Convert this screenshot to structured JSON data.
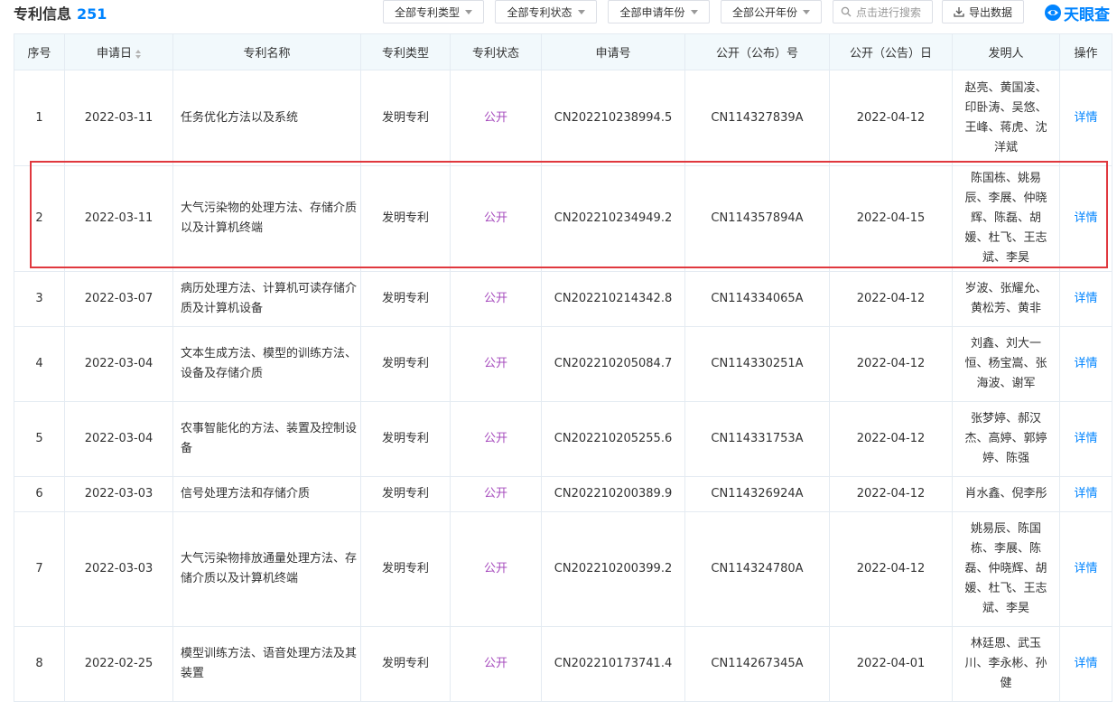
{
  "header": {
    "title": "专利信息",
    "count": "251",
    "filters": {
      "type": "全部专利类型",
      "status": "全部专利状态",
      "apply_year": "全部申请年份",
      "publish_year": "全部公开年份"
    },
    "search_placeholder": "点击进行搜索",
    "export_label": "导出数据",
    "logo_text": "天眼查"
  },
  "table": {
    "columns": [
      "序号",
      "申请日",
      "专利名称",
      "专利类型",
      "专利状态",
      "申请号",
      "公开（公布）号",
      "公开（公告）日",
      "发明人",
      "操作"
    ],
    "rows": [
      {
        "seq": "1",
        "apply_date": "2022-03-11",
        "name": "任务优化方法以及系统",
        "type": "发明专利",
        "status": "公开",
        "app_no": "CN202210238994.5",
        "pub_no": "CN114327839A",
        "pub_date": "2022-04-12",
        "inventors": [
          "赵亮、黄国凌、",
          "印卧涛、吴悠、",
          "王峰、蒋虎、沈",
          "洋斌"
        ],
        "action": "详情"
      },
      {
        "seq": "2",
        "apply_date": "2022-03-11",
        "name": "大气污染物的处理方法、存储介质以及计算机终端",
        "type": "发明专利",
        "status": "公开",
        "app_no": "CN202210234949.2",
        "pub_no": "CN114357894A",
        "pub_date": "2022-04-15",
        "inventors": [
          "陈国栋、姚易",
          "辰、李展、仲晓",
          "辉、陈磊、胡",
          "媛、杜飞、王志",
          "斌、李昊"
        ],
        "action": "详情"
      },
      {
        "seq": "3",
        "apply_date": "2022-03-07",
        "name": "病历处理方法、计算机可读存储介质及计算机设备",
        "type": "发明专利",
        "status": "公开",
        "app_no": "CN202210214342.8",
        "pub_no": "CN114334065A",
        "pub_date": "2022-04-12",
        "inventors": [
          "岁波、张耀允、",
          "黄松芳、黄非"
        ],
        "action": "详情"
      },
      {
        "seq": "4",
        "apply_date": "2022-03-04",
        "name": "文本生成方法、模型的训练方法、设备及存储介质",
        "type": "发明专利",
        "status": "公开",
        "app_no": "CN202210205084.7",
        "pub_no": "CN114330251A",
        "pub_date": "2022-04-12",
        "inventors": [
          "刘鑫、刘大一",
          "恒、杨宝嵩、张",
          "海波、谢军"
        ],
        "action": "详情"
      },
      {
        "seq": "5",
        "apply_date": "2022-03-04",
        "name": "农事智能化的方法、装置及控制设备",
        "type": "发明专利",
        "status": "公开",
        "app_no": "CN202210205255.6",
        "pub_no": "CN114331753A",
        "pub_date": "2022-04-12",
        "inventors": [
          "张梦婷、郝汉",
          "杰、高婷、郭婷",
          "婷、陈强"
        ],
        "action": "详情"
      },
      {
        "seq": "6",
        "apply_date": "2022-03-03",
        "name": "信号处理方法和存储介质",
        "type": "发明专利",
        "status": "公开",
        "app_no": "CN202210200389.9",
        "pub_no": "CN114326924A",
        "pub_date": "2022-04-12",
        "inventors": [
          "肖水鑫、倪李彤"
        ],
        "action": "详情"
      },
      {
        "seq": "7",
        "apply_date": "2022-03-03",
        "name": "大气污染物排放通量处理方法、存储介质以及计算机终端",
        "type": "发明专利",
        "status": "公开",
        "app_no": "CN202210200399.2",
        "pub_no": "CN114324780A",
        "pub_date": "2022-04-12",
        "inventors": [
          "姚易辰、陈国",
          "栋、李展、陈",
          "磊、仲晓辉、胡",
          "媛、杜飞、王志",
          "斌、李昊"
        ],
        "action": "详情"
      },
      {
        "seq": "8",
        "apply_date": "2022-02-25",
        "name": "模型训练方法、语音处理方法及其装置",
        "type": "发明专利",
        "status": "公开",
        "app_no": "CN202210173741.4",
        "pub_no": "CN114267345A",
        "pub_date": "2022-04-01",
        "inventors": [
          "林廷恩、武玉",
          "川、李永彬、孙",
          "健"
        ],
        "action": "详情"
      }
    ]
  },
  "colors": {
    "accent": "#0084ff",
    "status": "#a64bbd",
    "header_bg": "#f2f9fc",
    "highlight": "#e0383e"
  }
}
